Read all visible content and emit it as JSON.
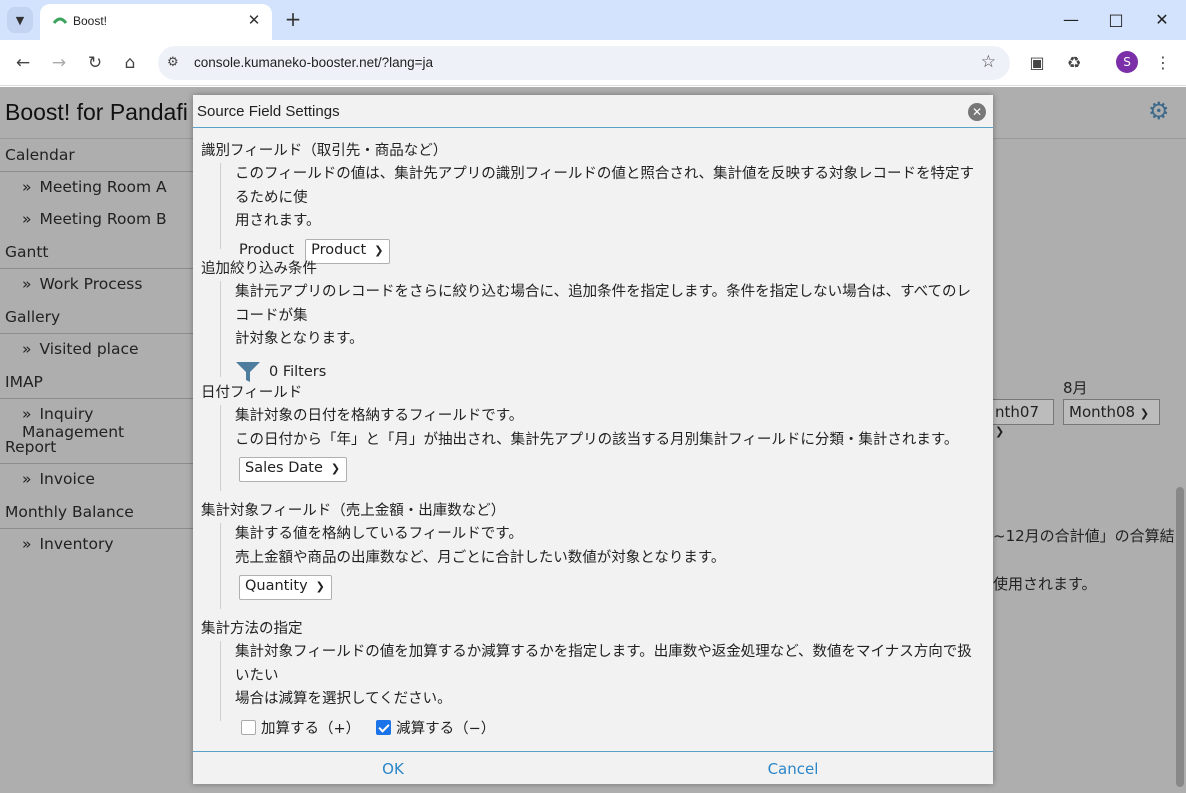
{
  "browser": {
    "tab_title": "Boost!",
    "url": "console.kumaneko-booster.net/?lang=ja",
    "profile_initial": "S"
  },
  "app": {
    "title": "Boost! for Pandafi",
    "sidebar": [
      {
        "group": "Calendar",
        "items": [
          "Meeting Room A",
          "Meeting Room B"
        ]
      },
      {
        "group": "Gantt",
        "items": [
          "Work Process"
        ]
      },
      {
        "group": "Gallery",
        "items": [
          "Visited place"
        ]
      },
      {
        "group": "IMAP",
        "items": [
          "Inquiry Management"
        ]
      },
      {
        "group": "Report",
        "items": [
          "Invoice"
        ]
      },
      {
        "group": "Monthly Balance",
        "items": [
          "Inventory"
        ]
      }
    ],
    "background": {
      "month_label": "8月",
      "select_partial": "nth07",
      "select_month08": "Month08",
      "text_1": "~12月の合計値」の合算結",
      "text_2": "使用されます。"
    }
  },
  "modal": {
    "title": "Source Field Settings",
    "sections": {
      "identifier": {
        "heading": "識別フィールド（取引先・商品など）",
        "desc_1": "このフィールドの値は、集計先アプリの識別フィールドの値と照合され、集計値を反映する対象レコードを特定するために使",
        "desc_2": "用されます。",
        "field_label": "Product",
        "field_value": "Product"
      },
      "filter": {
        "heading": "追加絞り込み条件",
        "desc_1": "集計元アプリのレコードをさらに絞り込む場合に、追加条件を指定します。条件を指定しない場合は、すべてのレコードが集",
        "desc_2": "計対象となります。",
        "filters_label": "0 Filters"
      },
      "date": {
        "heading": "日付フィールド",
        "desc_1": "集計対象の日付を格納するフィールドです。",
        "desc_2": "この日付から「年」と「月」が抽出され、集計先アプリの該当する月別集計フィールドに分類・集計されます。",
        "field_value": "Sales Date"
      },
      "target": {
        "heading": "集計対象フィールド（売上金額・出庫数など）",
        "desc_1": "集計する値を格納しているフィールドです。",
        "desc_2": "売上金額や商品の出庫数など、月ごとに合計したい数値が対象となります。",
        "field_value": "Quantity"
      },
      "method": {
        "heading": "集計方法の指定",
        "desc_1": "集計対象フィールドの値を加算するか減算するかを指定します。出庫数や返金処理など、数値をマイナス方向で扱いたい",
        "desc_2": "場合は減算を選択してください。",
        "add_label": "加算する（+）",
        "subtract_label": "減算する（−）",
        "add_checked": false,
        "subtract_checked": true
      }
    },
    "ok_label": "OK",
    "cancel_label": "Cancel"
  }
}
